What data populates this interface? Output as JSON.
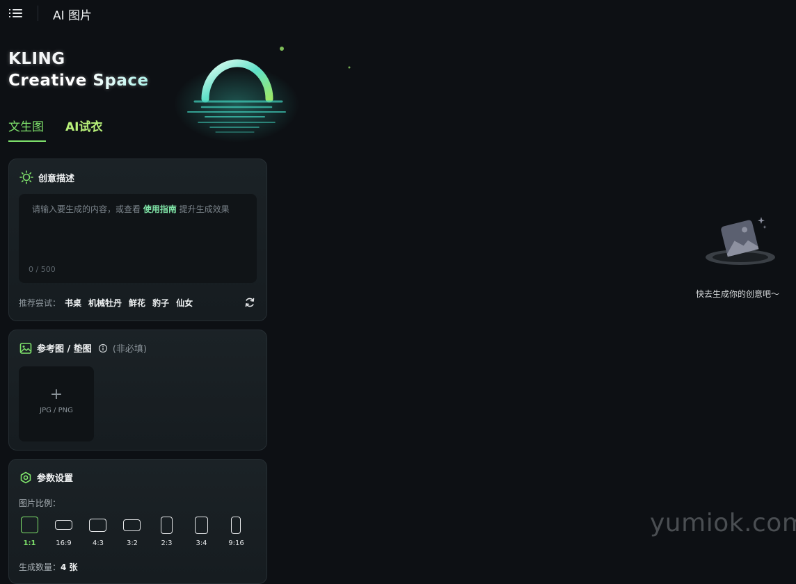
{
  "header": {
    "title": "AI 图片"
  },
  "brand": {
    "line1": "KLING",
    "line2": "Creative Space"
  },
  "tabs": [
    {
      "label": "文生图"
    },
    {
      "label": "AI试衣"
    }
  ],
  "prompt_card": {
    "title": "创意描述",
    "placeholder_before": "请输入要生成的内容，或查看 ",
    "guide_link": "使用指南",
    "placeholder_after": " 提升生成效果",
    "char_count": "0 / 500",
    "suggest_label": "推荐尝试：",
    "suggestions": [
      "书桌",
      "机械牡丹",
      "鲜花",
      "豹子",
      "仙女"
    ]
  },
  "reference_card": {
    "title": "参考图 / 垫图",
    "optional": "(非必填)",
    "upload_plus": "+",
    "upload_hint": "JPG / PNG"
  },
  "params_card": {
    "title": "参数设置",
    "ratio_label": "图片比例：",
    "ratios": [
      {
        "label": "1:1",
        "selected": true
      },
      {
        "label": "16:9",
        "selected": false
      },
      {
        "label": "4:3",
        "selected": false
      },
      {
        "label": "3:2",
        "selected": false
      },
      {
        "label": "2:3",
        "selected": false
      },
      {
        "label": "3:4",
        "selected": false
      },
      {
        "label": "9:16",
        "selected": false
      }
    ],
    "count_label": "生成数量：",
    "count_value": "4 张"
  },
  "empty_state": {
    "text": "快去生成你的创意吧～"
  },
  "watermark": "yumiok.com",
  "colors": {
    "accent": "#7fe36c",
    "background": "#0d1014",
    "card": "#1b2226"
  }
}
